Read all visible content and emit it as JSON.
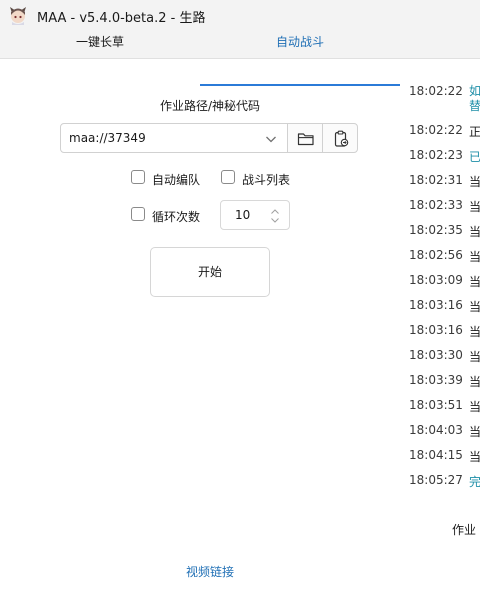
{
  "window": {
    "title": "MAA - v5.4.0-beta.2 - 生路"
  },
  "tabs": [
    {
      "label": "一键长草",
      "active": false
    },
    {
      "label": "自动战斗",
      "active": true
    }
  ],
  "copilot": {
    "path_label": "作业路径/神秘代码",
    "path_value": "maa://37349",
    "auto_formation_label": "自动编队",
    "auto_formation_checked": false,
    "battle_list_label": "战斗列表",
    "battle_list_checked": false,
    "loop_label": "循环次数",
    "loop_checked": false,
    "loop_count": "10",
    "start_label": "开始",
    "video_link_label": "视频链接"
  },
  "log": {
    "entries": [
      {
        "time": "18:02:22",
        "message": "如",
        "message2": "替",
        "color": "#1f8fa8"
      },
      {
        "time": "18:02:22",
        "message": "正",
        "color": "#1a1a1a"
      },
      {
        "time": "18:02:23",
        "message": "已",
        "color": "#1f8fa8"
      },
      {
        "time": "18:02:31",
        "message": "当",
        "color": "#1a1a1a"
      },
      {
        "time": "18:02:33",
        "message": "当",
        "color": "#1a1a1a"
      },
      {
        "time": "18:02:35",
        "message": "当",
        "color": "#1a1a1a"
      },
      {
        "time": "18:02:56",
        "message": "当",
        "color": "#1a1a1a"
      },
      {
        "time": "18:03:09",
        "message": "当",
        "color": "#1a1a1a"
      },
      {
        "time": "18:03:16",
        "message": "当",
        "color": "#1a1a1a"
      },
      {
        "time": "18:03:16",
        "message": "当",
        "color": "#1a1a1a"
      },
      {
        "time": "18:03:30",
        "message": "当",
        "color": "#1a1a1a"
      },
      {
        "time": "18:03:39",
        "message": "当",
        "color": "#1a1a1a"
      },
      {
        "time": "18:03:51",
        "message": "当",
        "color": "#1a1a1a"
      },
      {
        "time": "18:04:03",
        "message": "当",
        "color": "#1a1a1a"
      },
      {
        "time": "18:04:15",
        "message": "当",
        "color": "#1a1a1a"
      },
      {
        "time": "18:05:27",
        "message": "完",
        "color": "#1f8fa8"
      }
    ],
    "status_text": "作业"
  },
  "colors": {
    "accent": "#2b7bd8",
    "link": "#1f6fb5",
    "log_highlight": "#1f8fa8"
  }
}
